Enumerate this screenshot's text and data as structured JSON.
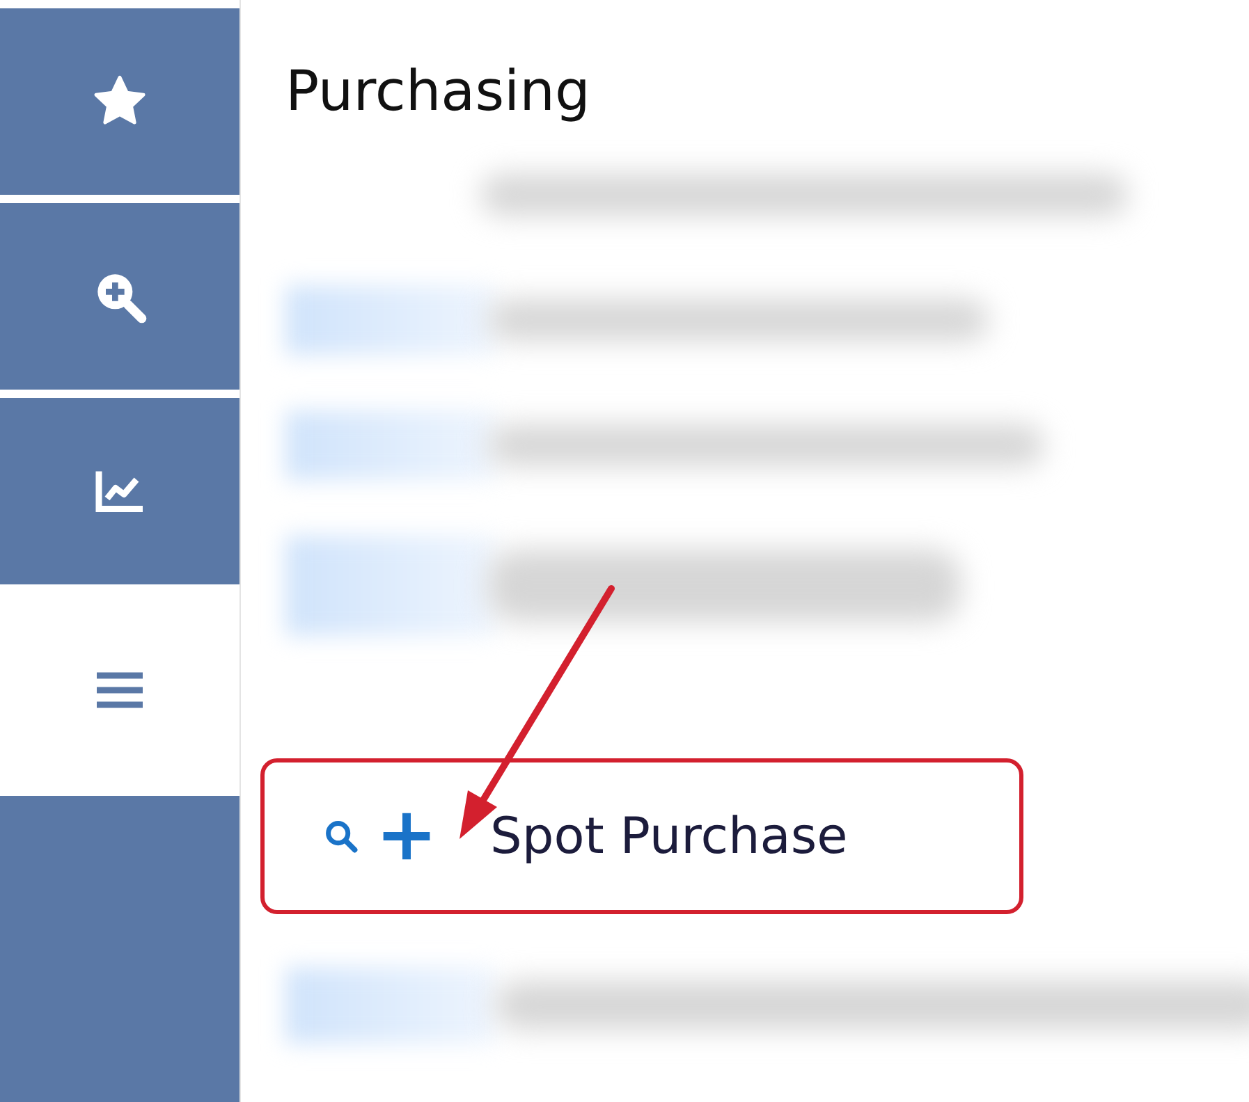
{
  "sidebar": {
    "items": [
      {
        "selected": false
      },
      {
        "selected": false
      },
      {
        "selected": false
      },
      {
        "selected": true
      }
    ]
  },
  "title": "Purchasing",
  "highlighted_item": {
    "label": "Spot Purchase",
    "highlighted": true
  }
}
